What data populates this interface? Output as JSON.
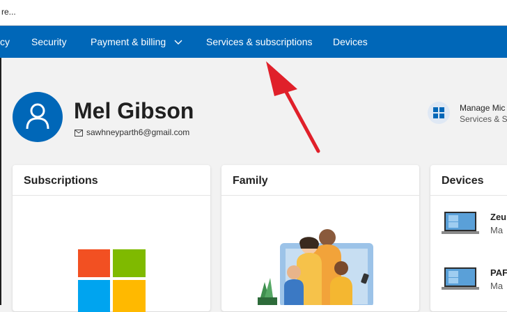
{
  "browser": {
    "address_fragment": "re..."
  },
  "nav": {
    "items": [
      {
        "label": "cy"
      },
      {
        "label": "Security"
      },
      {
        "label": "Payment & billing"
      },
      {
        "label": "Services & subscriptions"
      },
      {
        "label": "Devices"
      }
    ]
  },
  "profile": {
    "name": "Mel Gibson",
    "email": "sawhneyparth6@gmail.com"
  },
  "manage": {
    "title": "Manage Mic",
    "subtitle": "Services & Su"
  },
  "cards": {
    "subscriptions": {
      "title": "Subscriptions"
    },
    "family": {
      "title": "Family"
    },
    "devices": {
      "title": "Devices",
      "items": [
        {
          "name": "Zeu",
          "type": "Ma"
        },
        {
          "name": "PAF",
          "type": "Ma"
        }
      ]
    }
  },
  "colors": {
    "nav_bg": "#0067b8",
    "accent": "#0067b8",
    "annotation_arrow": "#e0202a"
  }
}
